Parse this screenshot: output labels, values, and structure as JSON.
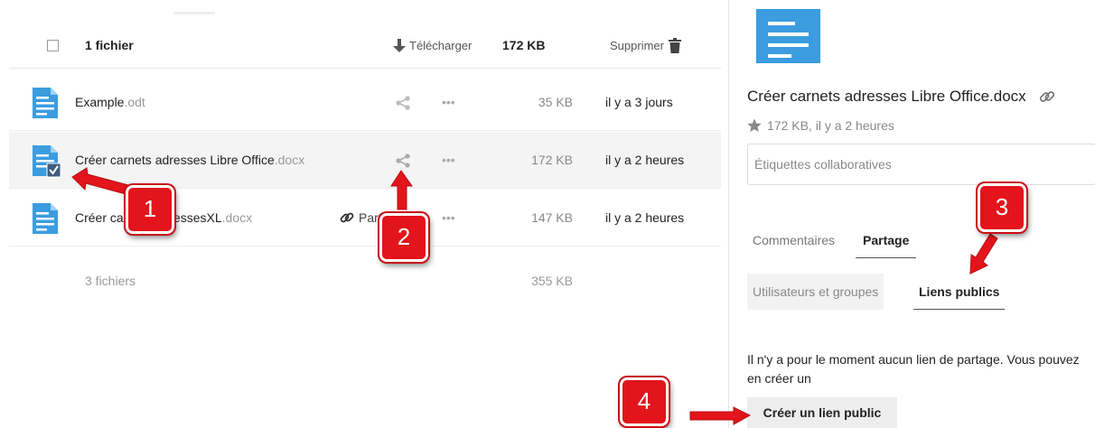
{
  "toolbar": {
    "selection_count": "1 fichier",
    "download_label": "Télécharger",
    "total_size": "172 KB",
    "delete_label": "Supprimer"
  },
  "files": [
    {
      "name": "Example",
      "ext": ".odt",
      "size": "35 KB",
      "date": "il y a 3 jours"
    },
    {
      "name": "Créer carnets adresses Libre Office",
      "ext": ".docx",
      "size": "172 KB",
      "date": "il y a 2 heures"
    },
    {
      "name": "Créer carnets adressesXL",
      "ext": ".docx",
      "size": "147 KB",
      "date": "il y a 2 heures",
      "share_label": "Partagé"
    }
  ],
  "footer": {
    "count": "3 fichiers",
    "size": "355 KB"
  },
  "details": {
    "filename": "Créer carnets adresses Libre Office.docx",
    "meta": "172 KB, il y a 2 heures",
    "tags_placeholder": "Étiquettes collaboratives",
    "tabs": {
      "comments": "Commentaires",
      "share": "Partage"
    },
    "subtabs": {
      "users": "Utilisateurs et groupes",
      "public": "Liens publics"
    },
    "no_link_message": "Il n'y a pour le moment aucun lien de partage. Vous pouvez en créer un",
    "create_button": "Créer un lien public"
  },
  "callouts": [
    "1",
    "2",
    "3",
    "4"
  ],
  "icons": {
    "file": "document-icon",
    "share": "share-icon",
    "more": "more-icon",
    "download": "download-icon",
    "delete": "trash-icon",
    "link": "link-icon",
    "favorite": "star-icon"
  },
  "colors": {
    "file_icon": "#3b9ce0",
    "callout": "#e3141b"
  }
}
